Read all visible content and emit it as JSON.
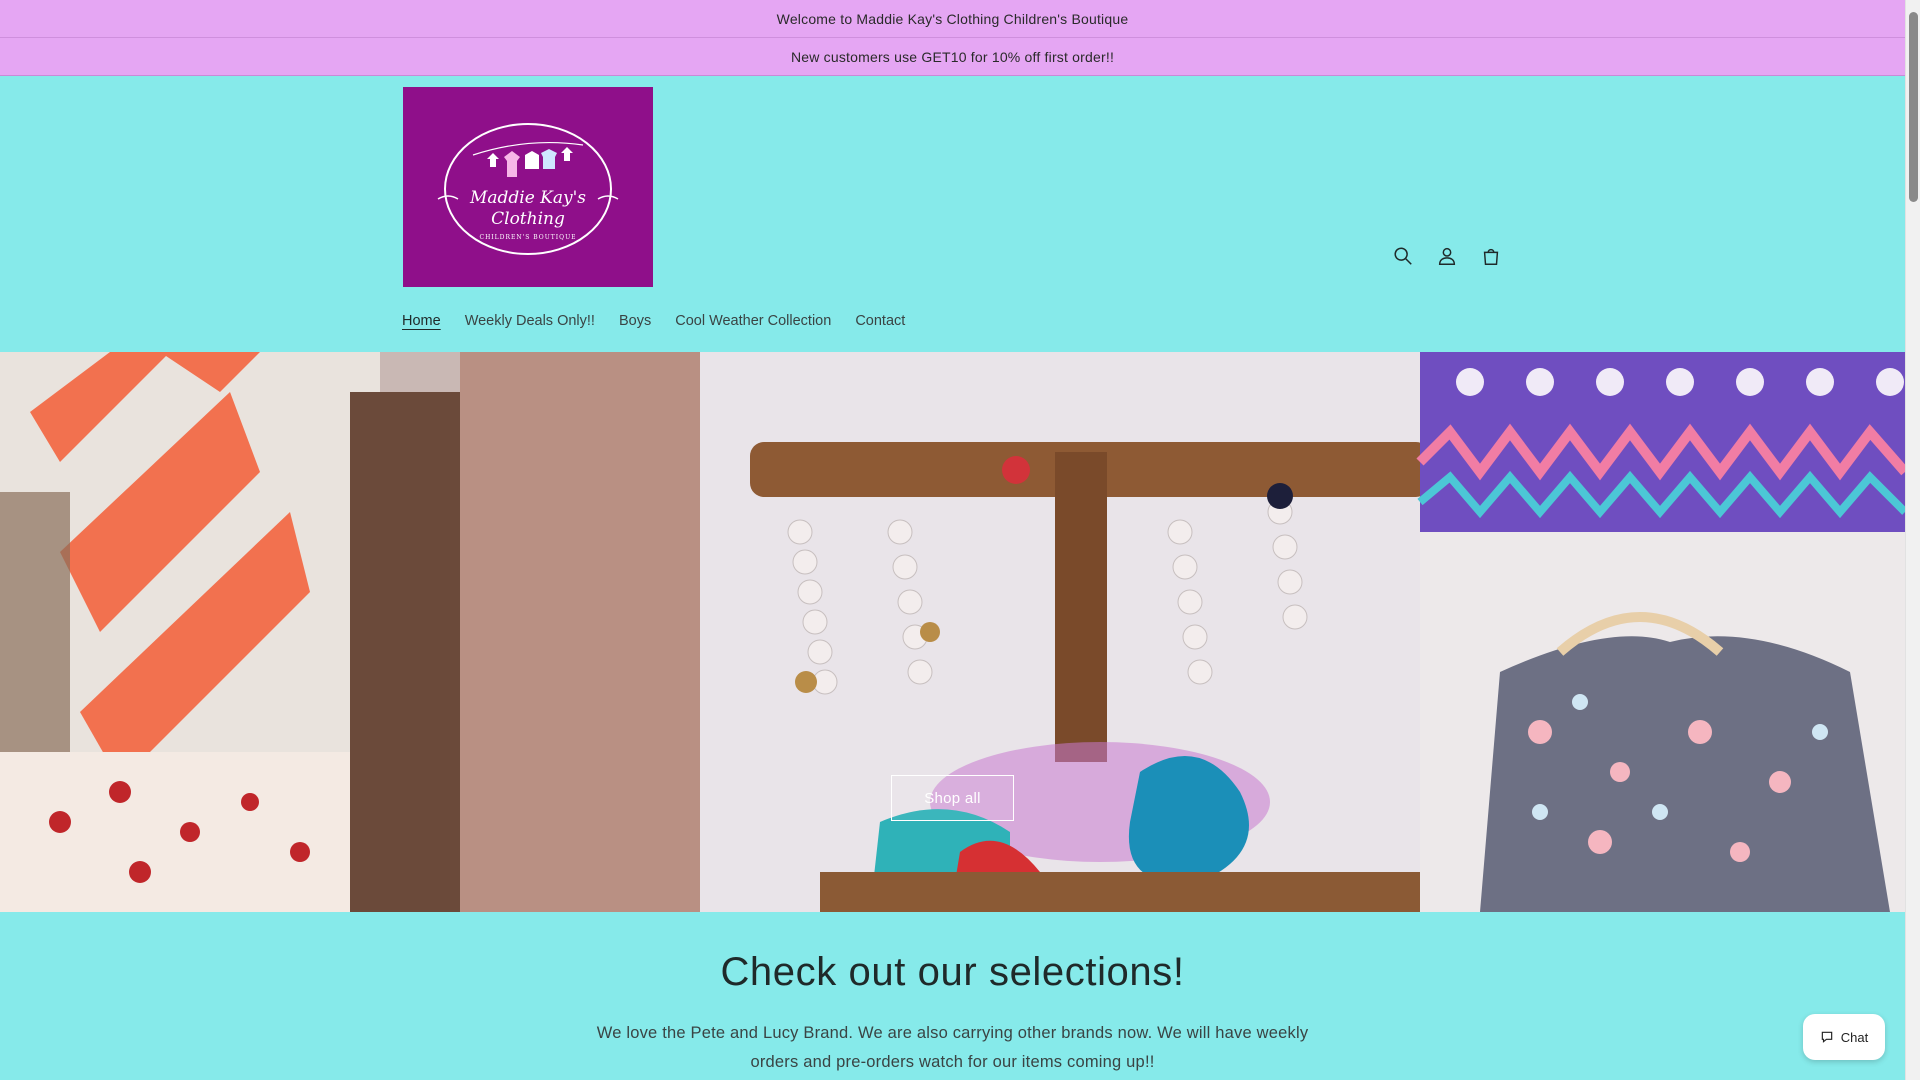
{
  "announcements": [
    "Welcome to Maddie Kay's Clothing Children's Boutique",
    "New customers use GET10 for 10% off first order!!"
  ],
  "logo": {
    "line1": "Maddie Kay's",
    "line2": "Clothing",
    "line3": "CHILDREN'S BOUTIQUE"
  },
  "header_icons": [
    "search-icon",
    "account-icon",
    "cart-icon"
  ],
  "nav": {
    "home": "Home",
    "weekly": "Weekly Deals Only!!",
    "boys": "Boys",
    "cool": "Cool Weather Collection",
    "contact": "Contact"
  },
  "hero": {
    "button": "Shop all"
  },
  "section": {
    "heading": "Check out our selections!",
    "body": "We love the Pete and Lucy Brand. We are also carrying other brands now. We will have weekly orders and pre-orders watch for our items coming up!!"
  },
  "chat": {
    "label": "Chat"
  },
  "colors": {
    "announcement_bar": "#e5a6f3",
    "page_background": "#86eaea",
    "logo_background": "#8f0f8a"
  }
}
